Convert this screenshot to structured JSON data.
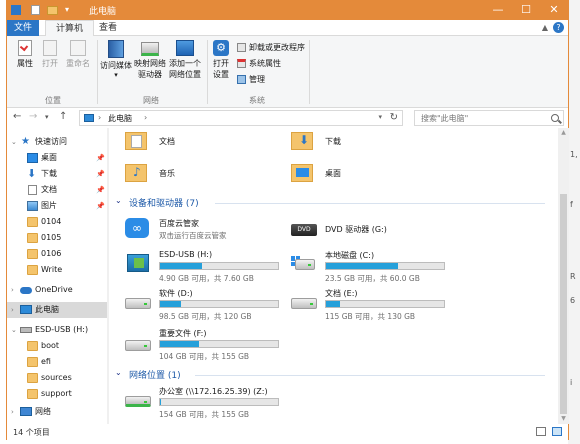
{
  "window": {
    "title": "此电脑",
    "accent": "#e48a3a"
  },
  "tabs": {
    "file": "文件",
    "computer": "计算机",
    "view": "查看"
  },
  "ribbon": {
    "location": {
      "label": "位置",
      "properties": "属性",
      "open": "打开",
      "rename": "重命名"
    },
    "network": {
      "label": "网络",
      "access_media": "访问媒体",
      "map_drive_1": "映射网络",
      "map_drive_2": "驱动器",
      "add_location_1": "添加一个",
      "add_location_2": "网络位置"
    },
    "system": {
      "label": "系统",
      "open_settings_1": "打开",
      "open_settings_2": "设置",
      "uninstall": "卸载或更改程序",
      "sys_props": "系统属性",
      "manage": "管理"
    }
  },
  "address": {
    "crumb": "此电脑",
    "search_placeholder": "搜索\"此电脑\""
  },
  "sidebar": {
    "quick_access": "快速访问",
    "items": [
      {
        "label": "桌面"
      },
      {
        "label": "下载"
      },
      {
        "label": "文档"
      },
      {
        "label": "图片"
      },
      {
        "label": "0104"
      },
      {
        "label": "0105"
      },
      {
        "label": "0106"
      },
      {
        "label": "Write"
      }
    ],
    "onedrive": "OneDrive",
    "this_pc": "此电脑",
    "usb": "ESD-USB (H:)",
    "usb_items": [
      {
        "label": "boot"
      },
      {
        "label": "efi"
      },
      {
        "label": "sources"
      },
      {
        "label": "support"
      }
    ],
    "network": "网络"
  },
  "folders": [
    {
      "name": "文档"
    },
    {
      "name": "下载"
    },
    {
      "name": "音乐"
    },
    {
      "name": "桌面"
    }
  ],
  "sections": {
    "devices": "设备和驱动器 (7)",
    "network": "网络位置 (1)"
  },
  "devices": {
    "baidu": {
      "name": "百度云管家",
      "sub": "双击运行百度云管家"
    },
    "dvd": {
      "name": "DVD 驱动器 (G:)"
    },
    "usb": {
      "name": "ESD-USB (H:)",
      "space": "4.90 GB 可用，共 7.60 GB",
      "used_fraction": 0.355
    },
    "local_c": {
      "name": "本地磁盘 (C:)",
      "space": "23.5 GB 可用，共 60.0 GB",
      "used_fraction": 0.608
    },
    "soft_d": {
      "name": "软件 (D:)",
      "space": "98.5 GB 可用，共 120 GB",
      "used_fraction": 0.179
    },
    "docs_e": {
      "name": "文档 (E:)",
      "space": "115 GB 可用，共 130 GB",
      "used_fraction": 0.115
    },
    "important_f": {
      "name": "重要文件 (F:)",
      "space": "104 GB 可用，共 155 GB",
      "used_fraction": 0.329
    }
  },
  "network_drives": {
    "office": {
      "name": "办公室 (\\\\172.16.25.39) (Z:)",
      "space": "154 GB 可用，共 155 GB",
      "used_fraction": 0.006
    }
  },
  "status": {
    "count": "14 个项目"
  }
}
